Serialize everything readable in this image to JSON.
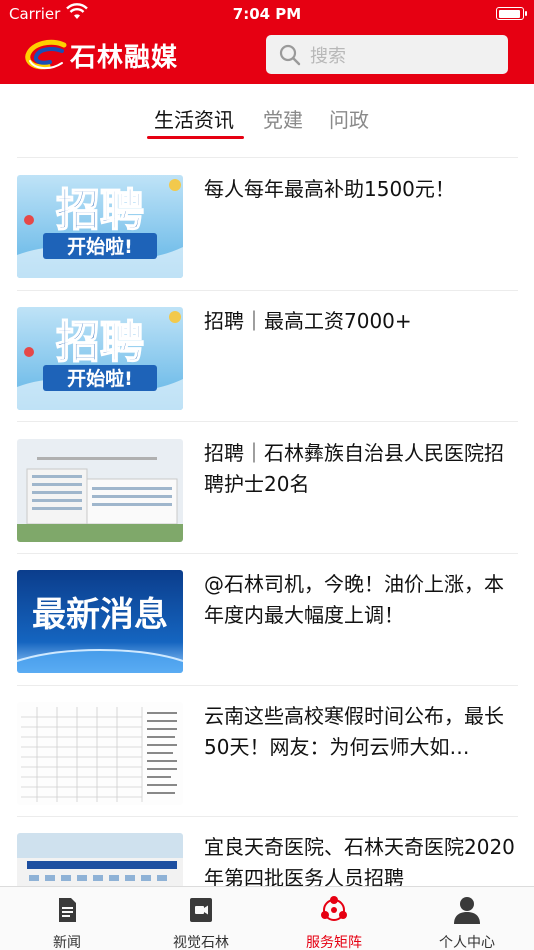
{
  "status_bar": {
    "carrier": "Carrier",
    "time": "7:04 PM",
    "battery_level": 0.92
  },
  "header": {
    "logo_text": "石林融媒",
    "search_placeholder": "搜索",
    "brand_color": "#e60012"
  },
  "tabs": [
    {
      "label": "生活资讯",
      "active": true
    },
    {
      "label": "党建",
      "active": false
    },
    {
      "label": "问政",
      "active": false
    }
  ],
  "articles": [
    {
      "title": "每人每年最高补助1500元！",
      "thumb": "recruit-banner",
      "thumb_text_1": "招聘",
      "thumb_text_2": "开始啦!"
    },
    {
      "title": "招聘｜最高工资7000+",
      "thumb": "recruit-banner",
      "thumb_text_1": "招聘",
      "thumb_text_2": "开始啦!"
    },
    {
      "title": "招聘｜石林彝族自治县人民医院招聘护士20名",
      "thumb": "hospital-photo"
    },
    {
      "title": "@石林司机，今晚！油价上涨，本年度内最大幅度上调！",
      "thumb": "news-banner",
      "thumb_text_1": "最新消息"
    },
    {
      "title": "云南这些高校寒假时间公布，最长50天！网友：为何云师大如…",
      "thumb": "schedule-table"
    },
    {
      "title": "宜良天奇医院、石林天奇医院2020年第四批医务人员招聘",
      "thumb": "hospital-building"
    }
  ],
  "tabbar": [
    {
      "label": "新闻",
      "icon": "news-icon",
      "active": false
    },
    {
      "label": "视觉石林",
      "icon": "video-icon",
      "active": false
    },
    {
      "label": "服务矩阵",
      "icon": "service-icon",
      "active": true
    },
    {
      "label": "个人中心",
      "icon": "profile-icon",
      "active": false
    }
  ]
}
